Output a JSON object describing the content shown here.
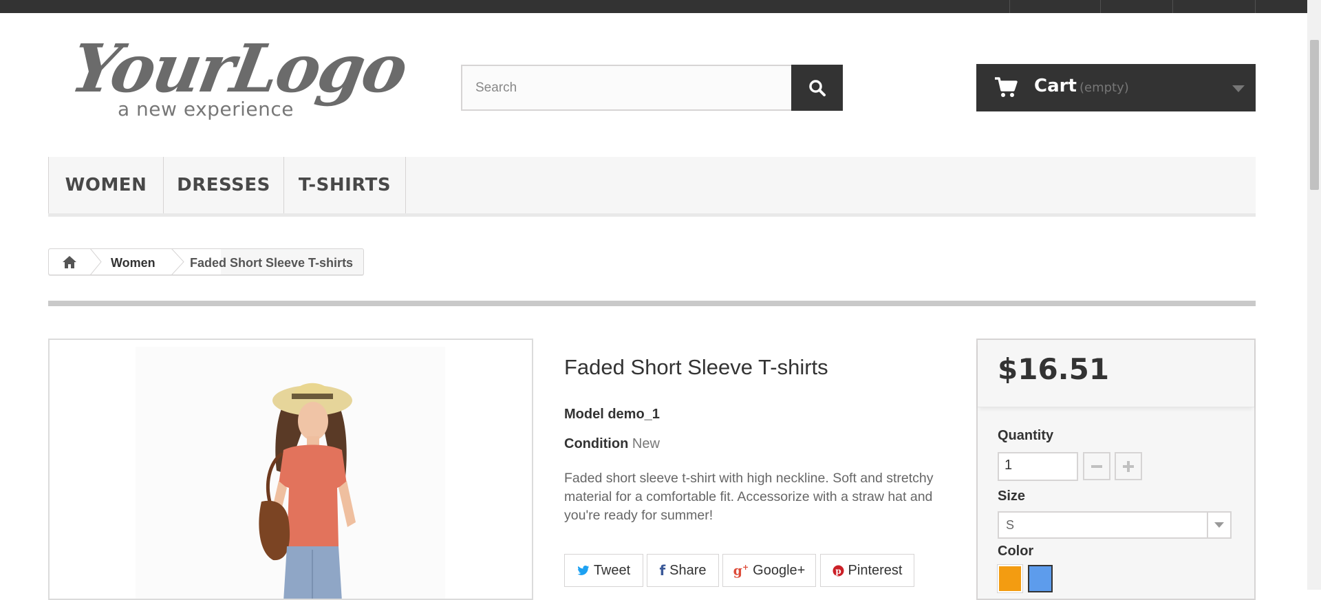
{
  "header": {
    "logo": {
      "script": "YourLogo",
      "tagline": "a new experience"
    },
    "search": {
      "placeholder": "Search"
    },
    "cart": {
      "title": "Cart",
      "status": "(empty)"
    }
  },
  "menu": {
    "items": [
      "WOMEN",
      "DRESSES",
      "T-SHIRTS"
    ]
  },
  "breadcrumb": {
    "category": "Women",
    "current": "Faded Short Sleeve T-shirts"
  },
  "product": {
    "name": "Faded Short Sleeve T-shirts",
    "model_label": "Model",
    "model_value": "demo_1",
    "condition_label": "Condition",
    "condition_value": "New",
    "description": "Faded short sleeve t-shirt with high neckline. Soft and stretchy material for a comfortable fit. Accessorize with a straw hat and you're ready for summer!"
  },
  "social": {
    "tweet": "Tweet",
    "share": "Share",
    "google": "Google+",
    "pinterest": "Pinterest"
  },
  "buy": {
    "price": "$16.51",
    "quantity_label": "Quantity",
    "quantity_value": "1",
    "size_label": "Size",
    "size_value": "S",
    "color_label": "Color",
    "colors": [
      "#f39c11",
      "#5d9cec"
    ]
  },
  "icons": {
    "search": "search-icon",
    "cart": "cart-icon",
    "home": "home-icon",
    "dropdown": "chevron-down-icon"
  }
}
